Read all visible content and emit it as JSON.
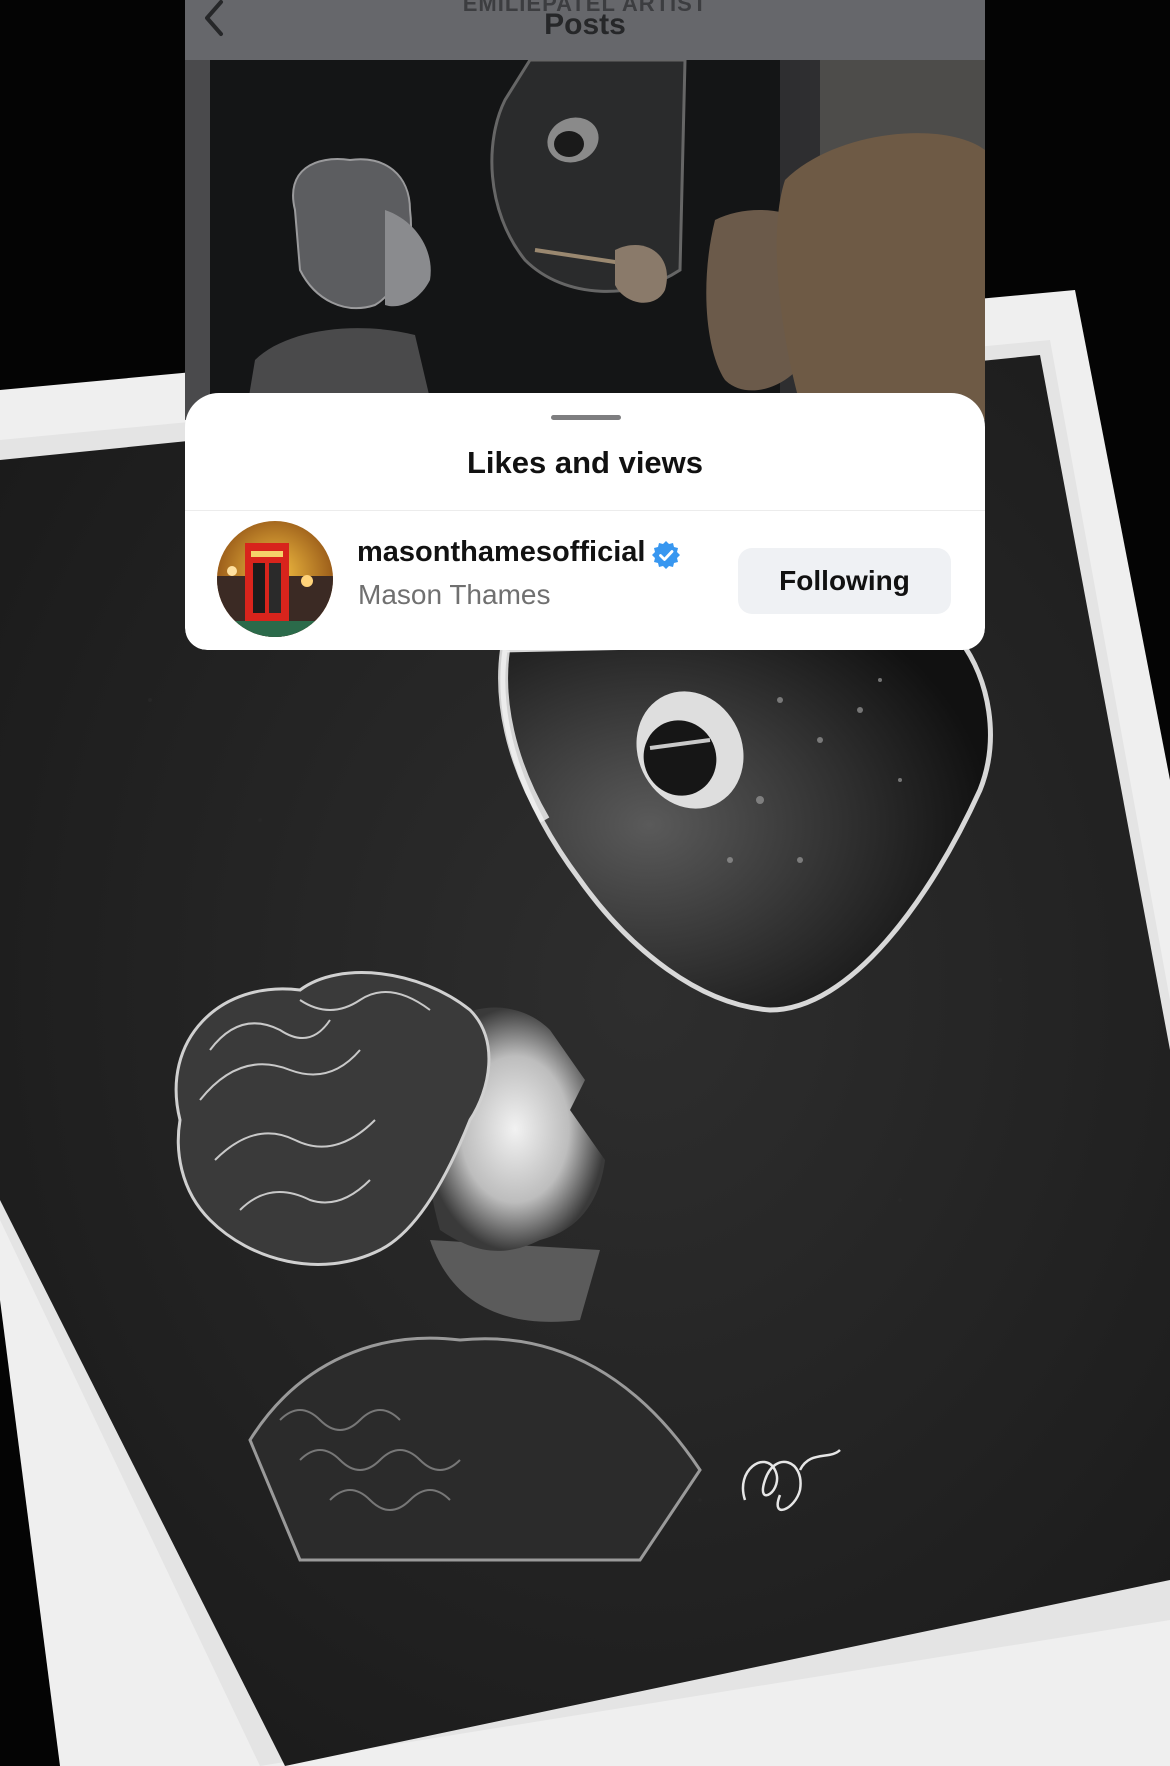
{
  "nav": {
    "subtitle": "EMILIEPATEL ARTIST",
    "title": "Posts",
    "back_icon": "chevron-left-icon"
  },
  "sheet": {
    "title": "Likes and views"
  },
  "liker": {
    "username": "masonthamesofficial",
    "full_name": "Mason Thames",
    "verified_icon": "verified-badge-icon",
    "follow_button_label": "Following"
  },
  "colors": {
    "verified_blue": "#3897f0",
    "button_bg": "#eff1f4",
    "nav_bg": "#66676b"
  }
}
